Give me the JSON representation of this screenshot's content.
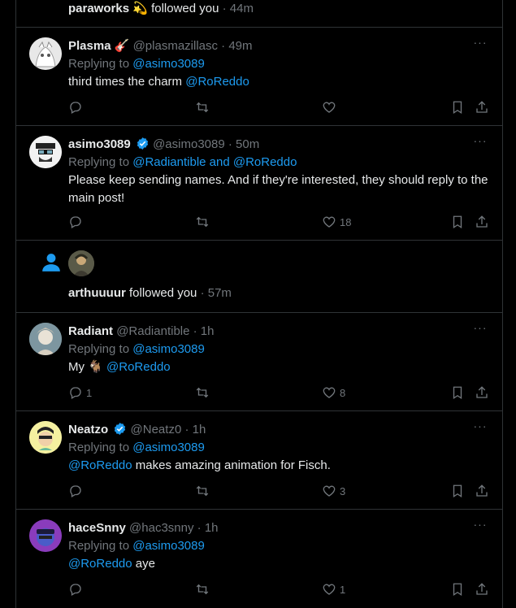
{
  "follow_top": {
    "user": "paraworks",
    "text": "followed you",
    "time": "· 44m"
  },
  "follow_mid": {
    "user": "arthuuuur",
    "text": "followed you",
    "time": "· 57m"
  },
  "replying_to_label": "Replying to",
  "posts": [
    {
      "name": "Plasma",
      "handle": "@plasmazillasc",
      "time": "· 49m",
      "reply_to": "@asimo3089",
      "text": "third times the charm",
      "mention": "@RoReddo",
      "reply_count": "",
      "like_count": ""
    },
    {
      "name": "asimo3089",
      "handle": "@asimo3089",
      "time": "· 50m",
      "reply_to": "@Radiantible and @RoReddo",
      "text": "Please keep sending names. And if they're interested, they should reply to the main post!",
      "reply_count": "",
      "like_count": "18"
    },
    {
      "name": "Radiant",
      "handle": "@Radiantible",
      "time": "· 1h",
      "reply_to": "@asimo3089",
      "text": "My",
      "mention": "@RoReddo",
      "reply_count": "1",
      "like_count": "8"
    },
    {
      "name": "Neatzo",
      "handle": "@Neatz0",
      "time": "· 1h",
      "reply_to": "@asimo3089",
      "mention": "@RoReddo",
      "text": "makes amazing animation for Fisch.",
      "reply_count": "",
      "like_count": "3"
    },
    {
      "name": "haceSnny",
      "handle": "@hac3snny",
      "time": "· 1h",
      "reply_to": "@asimo3089",
      "mention": "@RoReddo",
      "text": "aye",
      "reply_count": "",
      "like_count": "1"
    }
  ],
  "more_glyph": "···",
  "colors": {
    "accent": "#1d9bf0",
    "muted": "#71767b",
    "border": "#2f3336",
    "text": "#e7e9ea"
  }
}
